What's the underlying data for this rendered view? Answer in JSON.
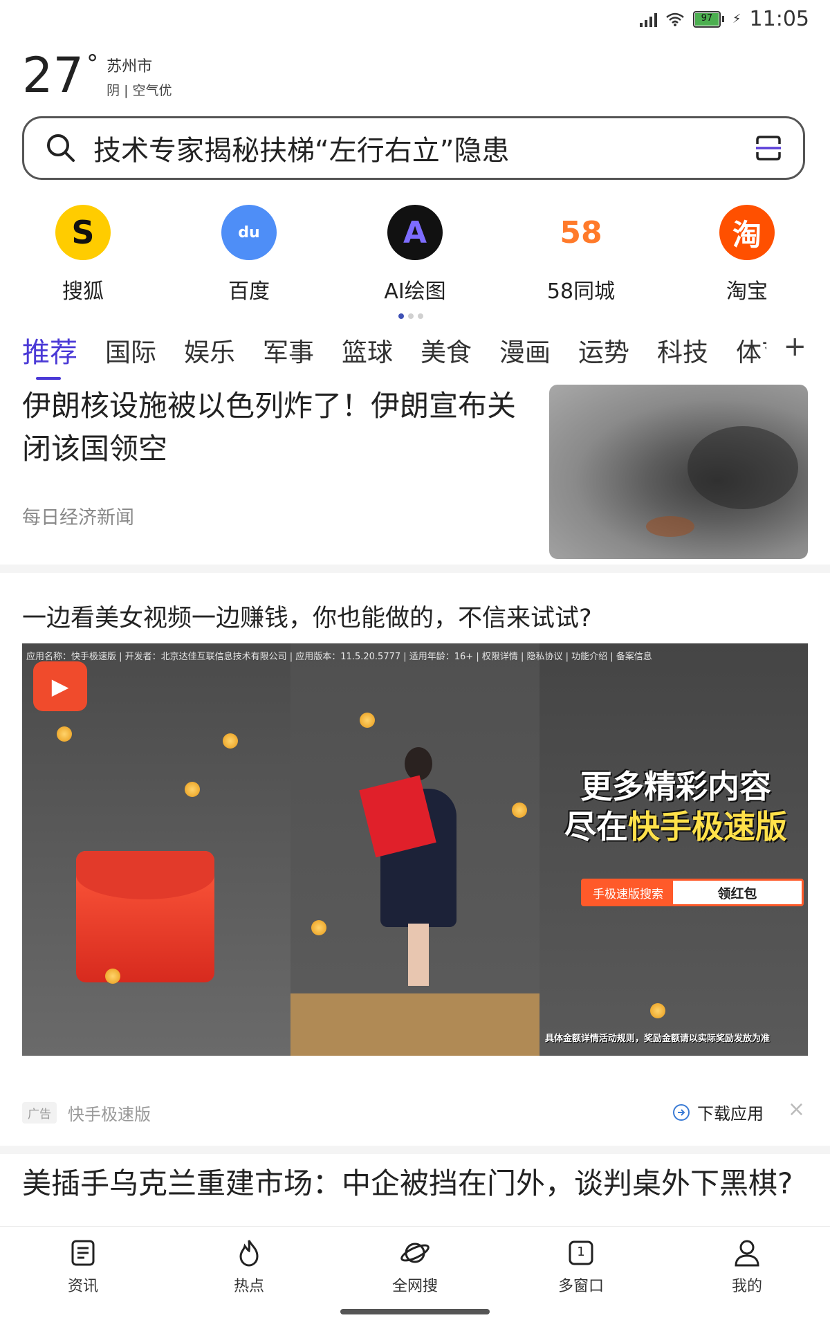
{
  "status_bar": {
    "battery": "97",
    "time": "11:05"
  },
  "weather": {
    "temperature": "27",
    "degree": "°",
    "city": "苏州市",
    "condition": "阴 | 空气优"
  },
  "search": {
    "query": "技术专家揭秘扶梯“左行右立”隐患",
    "icon": "search-icon",
    "scan_icon": "scan-icon"
  },
  "shortcuts": [
    {
      "label": "搜狐",
      "icon": "sohu-icon",
      "color": "#ffcc00"
    },
    {
      "label": "百度",
      "icon": "baidu-icon",
      "color": "#4e8ef7"
    },
    {
      "label": "AI绘图",
      "icon": "ai-draw-icon",
      "color": "#111111"
    },
    {
      "label": "58同城",
      "icon": "58-icon",
      "color": "#ffffff"
    },
    {
      "label": "淘宝",
      "icon": "taobao-icon",
      "color": "#ff5000"
    }
  ],
  "shortcut_glyphs": {
    "sohu": "S",
    "baidu": "du",
    "ai": "A",
    "c58": "58",
    "taobao": "淘"
  },
  "tabs": [
    "推荐",
    "国际",
    "娱乐",
    "军事",
    "篮球",
    "美食",
    "漫画",
    "运势",
    "科技",
    "体育"
  ],
  "tabs_plus": "+",
  "accent_color": "#4a39d6",
  "news1": {
    "title": "伊朗核设施被以色列炸了！伊朗宣布关闭该国领空",
    "source": "每日经济新闻"
  },
  "ad": {
    "headline": "一边看美女视频一边赚钱，你也能做的，不信来试试?",
    "info_line": "应用名称：快手极速版 | 开发者：北京达佳互联信息技术有限公司 | 应用版本：11.5.20.5777 | 适用年龄：16+ | 权限详情 | 隐私协议 | 功能介绍 | 备案信息",
    "overlay_line1": "更多精彩内容",
    "overlay_line2_prefix": "尽在",
    "overlay_line2_brand": "快手极速版",
    "overlay_search_left": "手极速版搜索",
    "overlay_search_right": "领红包",
    "overlay_bottom": "具体金额详情活动规则，奖励金额请以实际奖励发放为准",
    "tag": "广告",
    "advertiser": "快手极速版",
    "download_label": "下载应用",
    "close": "×"
  },
  "news3": {
    "title": "美插手乌克兰重建市场：中企被挡在门外，谈判桌外下黑棋?"
  },
  "bottom_nav": [
    {
      "label": "资讯",
      "icon": "news-icon"
    },
    {
      "label": "热点",
      "icon": "flame-icon"
    },
    {
      "label": "全网搜",
      "icon": "planet-icon"
    },
    {
      "label": "多窗口",
      "icon": "windows-icon",
      "count": "1"
    },
    {
      "label": "我的",
      "icon": "person-icon"
    }
  ]
}
